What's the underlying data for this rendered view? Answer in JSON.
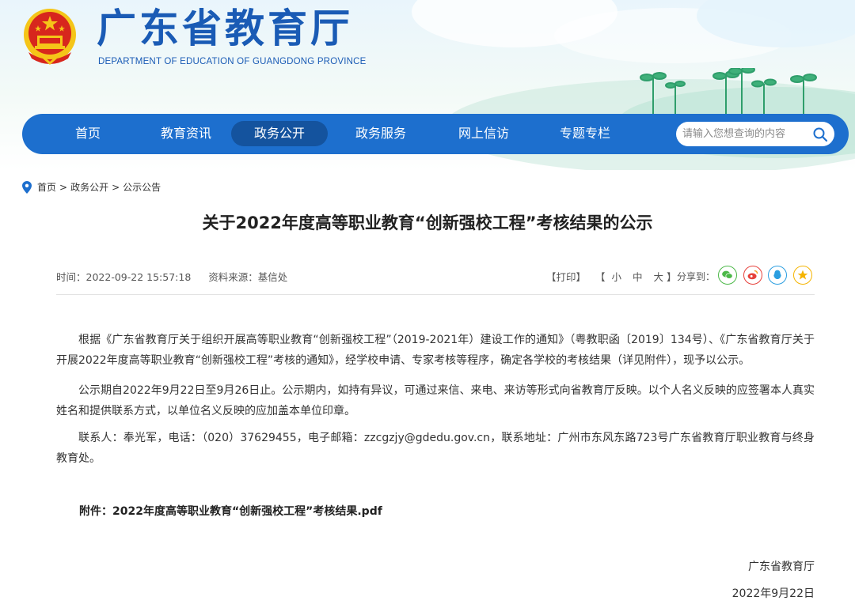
{
  "header": {
    "title": "广东省教育厅",
    "subtitle": "DEPARTMENT OF EDUCATION OF GUANGDONG PROVINCE"
  },
  "nav": {
    "items": [
      "首页",
      "教育资讯",
      "政务公开",
      "政务服务",
      "网上信访",
      "专题专栏"
    ],
    "active": "政务公开",
    "search_placeholder": "请输入您想查询的内容"
  },
  "breadcrumb": {
    "items": [
      "首页",
      "政务公开",
      "公示公告"
    ],
    "separator": ">"
  },
  "article": {
    "title": "关于2022年度高等职业教育“创新强校工程”考核结果的公示",
    "time_label": "时间：",
    "time": "2022-09-22 15:57:18",
    "source_label": "资料来源：",
    "source": "基信处",
    "print_label": "【打印】",
    "font_size_open": "【",
    "font_small": "小",
    "font_medium": "中",
    "font_large": "大",
    "font_size_close": "】",
    "share_label": "分享到：",
    "share_icons": [
      "wechat-icon",
      "weibo-icon",
      "qq-icon",
      "qzone-icon"
    ],
    "paragraphs": [
      "根据《广东省教育厅关于组织开展高等职业教育“创新强校工程”（2019-2021年）建设工作的通知》（粤教职函〔2019〕134号）、《广东省教育厅关于开展2022年度高等职业教育“创新强校工程”考核的通知》，经学校申请、专家考核等程序，确定各学校的考核结果（详见附件），现予以公示。",
      "公示期自2022年9月22日至9月26日止。公示期内，如持有异议，可通过来信、来电、来访等形式向省教育厅反映。以个人名义反映的应签署本人真实姓名和提供联系方式，以单位名义反映的应加盖本单位印章。",
      "联系人：奉光军，电话：（020）37629455，电子邮箱：zzcgzjy@gdedu.gov.cn，联系地址：广州市东风东路723号广东省教育厅职业教育与终身教育处。"
    ],
    "attachment": "附件：2022年度高等职业教育“创新强校工程”考核结果.pdf",
    "signature_org": "广东省教育厅",
    "signature_date": "2022年9月22日"
  },
  "colors": {
    "brand_blue": "#1a5bb5",
    "nav_blue": "#1d6fce",
    "nav_active": "#14539e",
    "emblem_red": "#d7261d",
    "emblem_gold": "#f5c518"
  }
}
